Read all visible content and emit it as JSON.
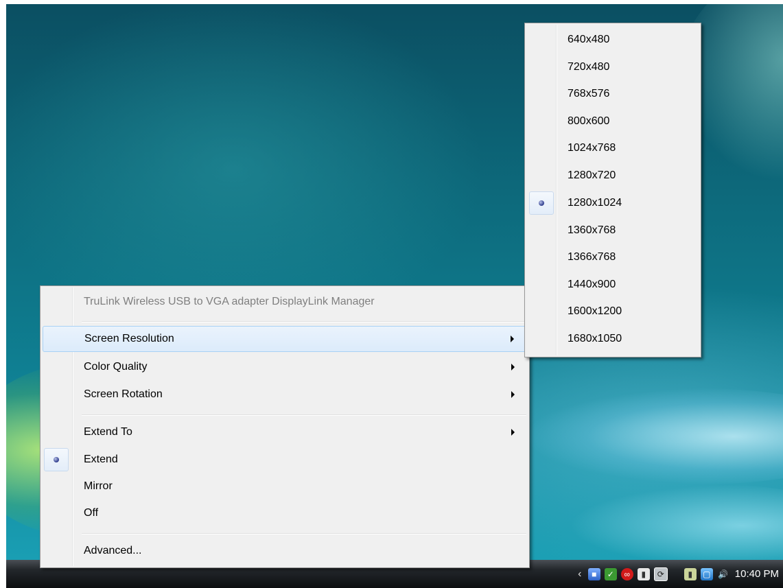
{
  "context_menu": {
    "header": "TruLink Wireless USB to VGA adapter DisplayLink Manager",
    "items": {
      "screen_resolution": "Screen Resolution",
      "color_quality": "Color Quality",
      "screen_rotation": "Screen Rotation",
      "extend_to": "Extend To",
      "extend": "Extend",
      "mirror": "Mirror",
      "off": "Off",
      "advanced": "Advanced..."
    },
    "selected_mode": "Extend"
  },
  "resolution_submenu": {
    "options": [
      "640x480",
      "720x480",
      "768x576",
      "800x600",
      "1024x768",
      "1280x720",
      "1280x1024",
      "1360x768",
      "1366x768",
      "1440x900",
      "1600x1200",
      "1680x1050"
    ],
    "selected": "1280x1024"
  },
  "taskbar": {
    "clock": "10:40 PM",
    "tray_icons": [
      "show-hidden-icons-arrow",
      "network-icon",
      "security-check-icon",
      "antivirus-icon",
      "document-icon",
      "sync-icon",
      "power-icon",
      "monitor-icon",
      "volume-icon"
    ]
  }
}
